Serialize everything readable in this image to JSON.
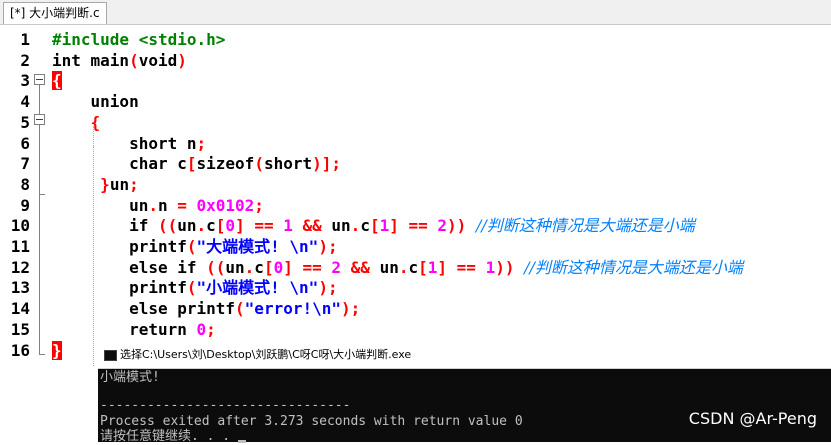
{
  "editor": {
    "tab_title": "[*] 大小端判断.c",
    "line_numbers": [
      "1",
      "2",
      "3",
      "4",
      "5",
      "6",
      "7",
      "8",
      "9",
      "10",
      "11",
      "12",
      "13",
      "14",
      "15",
      "16"
    ],
    "lines": [
      [
        [
          "pp",
          "#include <stdio.h>"
        ]
      ],
      [
        [
          "kw",
          "int "
        ],
        [
          "plain",
          "main"
        ],
        [
          "op",
          "("
        ],
        [
          "plain",
          "void"
        ],
        [
          "op",
          ")"
        ]
      ],
      [
        [
          "brace-hl",
          "{"
        ]
      ],
      [
        [
          "plain",
          "    "
        ],
        [
          "kw",
          "union"
        ]
      ],
      [
        [
          "plain",
          "    "
        ],
        [
          "op",
          "{"
        ]
      ],
      [
        [
          "plain",
          "        "
        ],
        [
          "kw",
          "short "
        ],
        [
          "plain",
          "n"
        ],
        [
          "op",
          ";"
        ]
      ],
      [
        [
          "plain",
          "        "
        ],
        [
          "kw",
          "char "
        ],
        [
          "plain",
          "c"
        ],
        [
          "op",
          "["
        ],
        [
          "kw",
          "sizeof"
        ],
        [
          "op",
          "("
        ],
        [
          "kw",
          "short"
        ],
        [
          "op",
          ")]"
        ],
        [
          "op",
          ";"
        ]
      ],
      [
        [
          "plain",
          "     "
        ],
        [
          "op",
          "}"
        ],
        [
          "plain",
          "un"
        ],
        [
          "op",
          ";"
        ]
      ],
      [
        [
          "plain",
          "        "
        ],
        [
          "plain",
          "un"
        ],
        [
          "op",
          "."
        ],
        [
          "plain",
          "n "
        ],
        [
          "op",
          "= "
        ],
        [
          "num",
          "0x0102"
        ],
        [
          "op",
          ";"
        ]
      ],
      [
        [
          "plain",
          "        "
        ],
        [
          "kw",
          "if "
        ],
        [
          "op",
          "(("
        ],
        [
          "plain",
          "un"
        ],
        [
          "op",
          "."
        ],
        [
          "plain",
          "c"
        ],
        [
          "op",
          "["
        ],
        [
          "num",
          "0"
        ],
        [
          "op",
          "] == "
        ],
        [
          "num",
          "1 "
        ],
        [
          "op",
          "&& "
        ],
        [
          "plain",
          "un"
        ],
        [
          "op",
          "."
        ],
        [
          "plain",
          "c"
        ],
        [
          "op",
          "["
        ],
        [
          "num",
          "1"
        ],
        [
          "op",
          "] == "
        ],
        [
          "num",
          "2"
        ],
        [
          "op",
          ")) "
        ],
        [
          "cm",
          "//判断这种情况是大端还是小端"
        ]
      ],
      [
        [
          "plain",
          "        "
        ],
        [
          "plain",
          "printf"
        ],
        [
          "op",
          "("
        ],
        [
          "str",
          "\"大端模式! \\n\""
        ],
        [
          "op",
          ");"
        ]
      ],
      [
        [
          "plain",
          "        "
        ],
        [
          "kw",
          "else if "
        ],
        [
          "op",
          "(("
        ],
        [
          "plain",
          "un"
        ],
        [
          "op",
          "."
        ],
        [
          "plain",
          "c"
        ],
        [
          "op",
          "["
        ],
        [
          "num",
          "0"
        ],
        [
          "op",
          "] == "
        ],
        [
          "num",
          "2 "
        ],
        [
          "op",
          "&& "
        ],
        [
          "plain",
          "un"
        ],
        [
          "op",
          "."
        ],
        [
          "plain",
          "c"
        ],
        [
          "op",
          "["
        ],
        [
          "num",
          "1"
        ],
        [
          "op",
          "] == "
        ],
        [
          "num",
          "1"
        ],
        [
          "op",
          ")) "
        ],
        [
          "cm",
          "//判断这种情况是大端还是小端"
        ]
      ],
      [
        [
          "plain",
          "        "
        ],
        [
          "plain",
          "printf"
        ],
        [
          "op",
          "("
        ],
        [
          "str",
          "\"小端模式! \\n\""
        ],
        [
          "op",
          ");"
        ]
      ],
      [
        [
          "plain",
          "        "
        ],
        [
          "kw",
          "else "
        ],
        [
          "plain",
          "printf"
        ],
        [
          "op",
          "("
        ],
        [
          "str",
          "\"error!\\n\""
        ],
        [
          "op",
          ");"
        ]
      ],
      [
        [
          "plain",
          "        "
        ],
        [
          "kw",
          "return "
        ],
        [
          "num",
          "0"
        ],
        [
          "op",
          ";"
        ]
      ],
      [
        [
          "brace-hl",
          "}"
        ]
      ]
    ]
  },
  "console": {
    "title": "选择C:\\Users\\刘\\Desktop\\刘跃鹏\\C呀C呀\\大小端判断.exe",
    "output_line1": "小端模式!",
    "separator": "--------------------------------",
    "output_line3": "Process exited after 3.273 seconds with return value 0",
    "output_line4": "请按任意键继续. . . "
  },
  "watermark": "CSDN @Ar-Peng"
}
